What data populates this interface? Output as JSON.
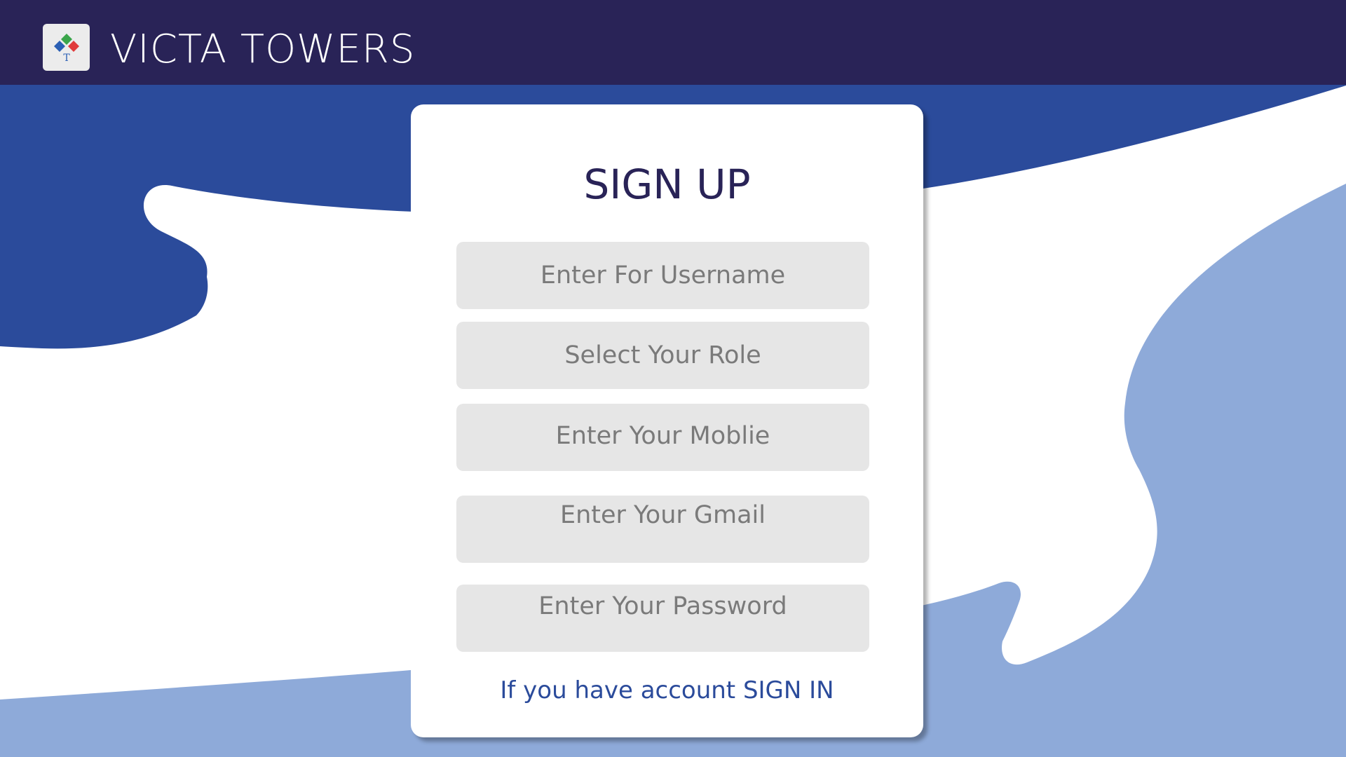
{
  "app": {
    "brand_name": "VICTA TOWERS",
    "logo_letter": "T"
  },
  "form": {
    "title": "SIGN UP",
    "fields": [
      {
        "placeholder": "Enter For Username"
      },
      {
        "placeholder": "Select Your Role"
      },
      {
        "placeholder": "Enter Your Moblie"
      },
      {
        "placeholder": "Enter Your Gmail"
      },
      {
        "placeholder": "Enter Your Password"
      }
    ],
    "signin_text": "If you have account SIGN IN"
  },
  "colors": {
    "header": "#292357",
    "wave_dark": "#2b4b9b",
    "wave_light": "#8eaad9",
    "field_bg": "#e6e6e6",
    "link": "#2b4b9b"
  },
  "icons": {
    "logo": "diamond-logo-icon"
  }
}
